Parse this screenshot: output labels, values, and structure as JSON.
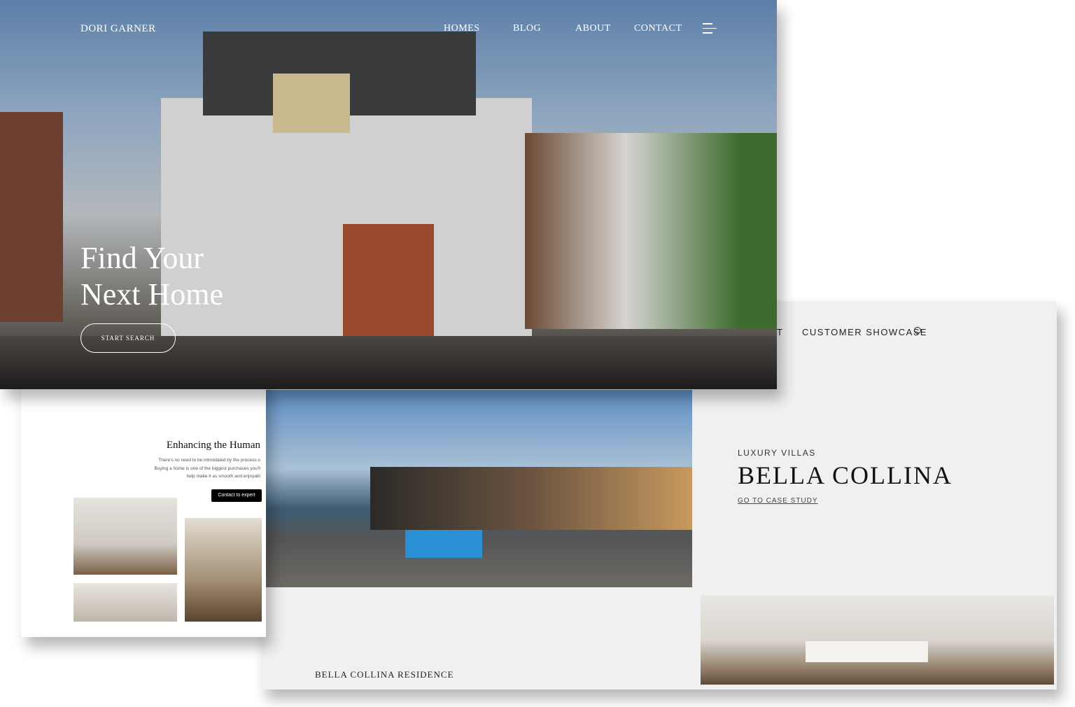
{
  "hero": {
    "brand": "DORI GARNER",
    "nav": [
      "HOMES",
      "BLOG",
      "ABOUT",
      "CONTACT"
    ],
    "menu_icon": "hamburger-icon",
    "headline_1": "Find Your",
    "headline_2": "Next Home",
    "cta": "START SEARCH"
  },
  "left": {
    "title": "Enhancing the Human",
    "body": [
      "There's no need to be intimidated by the process o",
      "Buying a home is one of the biggest purchases you'll",
      "help make it as smooth and enjoyabl"
    ],
    "button": "Contact to expert"
  },
  "showcase": {
    "nav_partial": "T",
    "nav_item": "CUSTOMER SHOWCASE",
    "search_icon": "search-icon",
    "eyebrow": "LUXURY VILLAS",
    "title": "BELLA COLLINA",
    "link": "GO TO CASE STUDY",
    "caption": "BELLA COLLINA RESIDENCE"
  }
}
